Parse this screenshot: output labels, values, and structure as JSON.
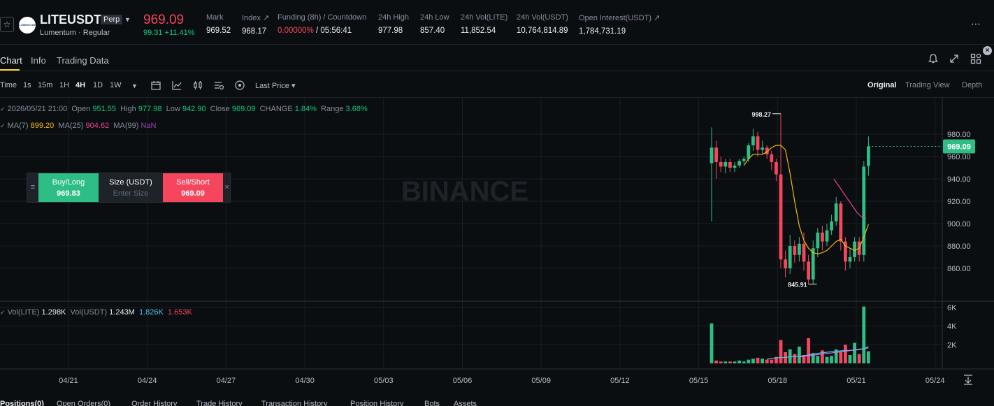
{
  "header": {
    "favorite_icon": "star-icon",
    "logo_text": "LUMENTUM",
    "symbol": "LITEUSDT",
    "contract_type": "Perp",
    "subtitle": "Lumentum · Regular",
    "last_price": "969.09",
    "change": "99.31 +11.41%",
    "stats": {
      "mark_label": "Mark",
      "mark_value": "969.52",
      "index_label": "Index ↗",
      "index_value": "968.17",
      "funding_label": "Funding (8h) / Countdown",
      "funding_rate": "0.00000%",
      "countdown": "/ 05:56:41",
      "high_label": "24h High",
      "high_value": "977.98",
      "low_label": "24h Low",
      "low_value": "857.40",
      "vol_lite_label": "24h Vol(LITE)",
      "vol_lite_value": "11,852.54",
      "vol_usdt_label": "24h Vol(USDT)",
      "vol_usdt_value": "10,764,814.89",
      "oi_label": "Open Interest(USDT) ↗",
      "oi_value": "1,784,731.19"
    },
    "more_icon": "more-dots-icon"
  },
  "tabs": {
    "chart": "Chart",
    "info": "Info",
    "trading_data": "Trading Data"
  },
  "toolbar": {
    "intervals": [
      "Time",
      "1s",
      "15m",
      "1H",
      "4H",
      "1D",
      "1W"
    ],
    "active_interval": "4H",
    "price_type": "Last Price ▾",
    "views": [
      "Original",
      "Trading View",
      "Depth"
    ],
    "active_view": "Original"
  },
  "legend": {
    "datetime": "2026/05/21 21:00",
    "open_label": "Open",
    "open": "951.55",
    "high_label": "High",
    "high": "977.98",
    "low_label": "Low",
    "low": "942.90",
    "close_label": "Close",
    "close": "969.09",
    "change_label": "CHANGE",
    "change": "1.84%",
    "range_label": "Range",
    "range": "3.68%",
    "ma7_label": "MA(7)",
    "ma7": "899.20",
    "ma25_label": "MA(25)",
    "ma25": "904.62",
    "ma99_label": "MA(99)",
    "ma99": "NaN",
    "vol_lite_label": "Vol(LITE)",
    "vol_lite": "1.298K",
    "vol_usdt_label": "Vol(USDT)",
    "vol_usdt": "1.243M",
    "vol_ma1": "1.826K",
    "vol_ma2": "1.653K"
  },
  "order_widget": {
    "buy_label": "Buy/Long",
    "buy_price": "969.83",
    "size_label": "Size (USDT)",
    "size_placeholder": "Enter Size",
    "sell_label": "Sell/Short",
    "sell_price": "969.09"
  },
  "watermark": "BINANCE",
  "chart_data": {
    "type": "candlestick",
    "price_ticks": [
      "980.00",
      "960.00",
      "940.00",
      "920.00",
      "900.00",
      "880.00",
      "860.00"
    ],
    "price_tick_values": [
      980,
      960,
      940,
      920,
      900,
      880,
      860
    ],
    "volume_ticks": [
      "6K",
      "4K",
      "2K"
    ],
    "volume_tick_values": [
      6000,
      4000,
      2000
    ],
    "date_ticks": [
      "04/21",
      "04/24",
      "04/27",
      "04/30",
      "05/03",
      "05/06",
      "05/09",
      "05/12",
      "05/15",
      "05/18",
      "05/21",
      "05/24"
    ],
    "current_price": "969.09",
    "current_price_value": 969.09,
    "max_label": "998.27",
    "max_value": 998.27,
    "min_label": "845.91",
    "min_value": 845.91,
    "colors": {
      "up": "#2ebd85",
      "down": "#f6465d",
      "ma7": "#f0b90b",
      "ma25": "#e84393"
    },
    "candles": [
      [
        954,
        968,
        902,
        986
      ],
      [
        968,
        955,
        940,
        974
      ],
      [
        955,
        951,
        946,
        960
      ],
      [
        951,
        955,
        945,
        958
      ],
      [
        955,
        950,
        946,
        958
      ],
      [
        950,
        952,
        946,
        955
      ],
      [
        952,
        956,
        950,
        958
      ],
      [
        956,
        958,
        954,
        960
      ],
      [
        958,
        970,
        955,
        972
      ],
      [
        970,
        978,
        965,
        985
      ],
      [
        978,
        966,
        960,
        982
      ],
      [
        966,
        968,
        962,
        974
      ],
      [
        968,
        962,
        958,
        970
      ],
      [
        962,
        955,
        948,
        965
      ],
      [
        955,
        944,
        938,
        958
      ],
      [
        944,
        868,
        860,
        998.27
      ],
      [
        868,
        860,
        852,
        876
      ],
      [
        860,
        880,
        855,
        890
      ],
      [
        880,
        872,
        865,
        885
      ],
      [
        872,
        882,
        866,
        888
      ],
      [
        882,
        866,
        858,
        892
      ],
      [
        866,
        850,
        845.91,
        872
      ],
      [
        850,
        878,
        846,
        885
      ],
      [
        878,
        892,
        870,
        896
      ],
      [
        892,
        884,
        876,
        898
      ],
      [
        884,
        894,
        880,
        900
      ],
      [
        894,
        902,
        890,
        908
      ],
      [
        902,
        918,
        898,
        924
      ],
      [
        918,
        884,
        876,
        920
      ],
      [
        884,
        866,
        858,
        888
      ],
      [
        866,
        870,
        860,
        878
      ],
      [
        870,
        884,
        866,
        888
      ],
      [
        884,
        872,
        866,
        888
      ],
      [
        872,
        951,
        866,
        956
      ],
      [
        951.55,
        969.09,
        942.9,
        977.98
      ]
    ],
    "ma7": [
      952,
      958,
      962,
      962,
      962,
      964,
      968,
      970,
      970,
      966,
      945,
      920,
      898,
      885,
      878,
      874,
      873,
      874,
      876,
      880,
      884,
      886,
      880,
      878,
      876,
      878,
      888,
      899.2
    ],
    "ma25": [
      940,
      934,
      928,
      922,
      916,
      910,
      906,
      904.62
    ],
    "volume": [
      4300,
      300,
      200,
      200,
      200,
      200,
      300,
      200,
      400,
      500,
      600,
      500,
      400,
      400,
      700,
      2500,
      1200,
      1500,
      1000,
      1800,
      900,
      2700,
      1100,
      800,
      1400,
      700,
      800,
      1500,
      1200,
      2000,
      900,
      2200,
      1000,
      6100,
      1298
    ],
    "volume_ma": [
      450,
      520,
      600,
      620,
      650,
      700,
      720,
      760,
      820,
      900,
      1000,
      1080,
      1150,
      1200,
      1250,
      1300,
      1350,
      1380,
      1400,
      1420,
      1480,
      1550,
      1826
    ],
    "volume_ma2": [
      700,
      760,
      820,
      880,
      940,
      1000,
      1060,
      1120,
      1180,
      1240,
      1300,
      1380,
      1450,
      1520,
      1580,
      1653
    ]
  },
  "bottom_tabs": [
    "Positions(0)",
    "Open Orders(0)",
    "Order History",
    "Trade History",
    "Transaction History",
    "Position History",
    "Bots",
    "Assets"
  ]
}
